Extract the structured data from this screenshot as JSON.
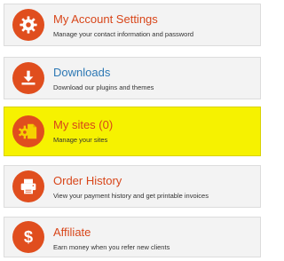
{
  "menu": {
    "items": [
      {
        "title": "My Account Settings",
        "desc": "Manage your contact information and password",
        "icon": "gear-icon"
      },
      {
        "title": "Downloads",
        "desc": "Download our plugins and themes",
        "icon": "download-icon"
      },
      {
        "title": "My sites (0)",
        "desc": "Manage your sites",
        "icon": "site-gear-document-icon"
      },
      {
        "title": "Order History",
        "desc": "View your payment history and get printable invoices",
        "icon": "printer-icon"
      },
      {
        "title": "Affiliate",
        "desc": "Earn money when you refer new clients",
        "icon": "dollar-icon"
      }
    ]
  },
  "colors": {
    "icon_bg": "#e04e1e",
    "title_orange": "#d8461a",
    "title_blue": "#2d78b4",
    "highlight": "#f6f200"
  }
}
